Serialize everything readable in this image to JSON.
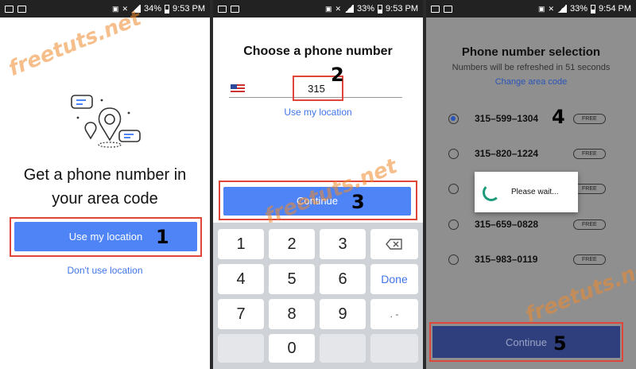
{
  "status_bars": [
    {
      "battery": "34%",
      "time": "9:53 PM"
    },
    {
      "battery": "33%",
      "time": "9:53 PM"
    },
    {
      "battery": "33%",
      "time": "9:54 PM"
    }
  ],
  "watermark": "freetuts.net",
  "screen1": {
    "title_line1": "Get a phone number in",
    "title_line2": "your area code",
    "use_location_button": "Use my location",
    "dont_use_location_link": "Don't use location",
    "step_marker": "1"
  },
  "screen2": {
    "title": "Choose a phone number",
    "area_code_value": "315",
    "use_location_link": "Use my location",
    "continue_button": "Continue",
    "step_marker_input": "2",
    "step_marker_continue": "3",
    "keypad": {
      "keys": [
        "1",
        "2",
        "3",
        "4",
        "5",
        "6",
        "7",
        "8",
        "9",
        "0"
      ],
      "done_label": "Done",
      "symbol_label": ". -"
    }
  },
  "screen3": {
    "title": "Phone number selection",
    "subtitle": "Numbers will be refreshed in 51 seconds",
    "change_area_link": "Change area code",
    "numbers": [
      {
        "number": "315–599–1304",
        "badge": "FREE",
        "selected": true
      },
      {
        "number": "315–820–1224",
        "badge": "FREE",
        "selected": false
      },
      {
        "number": "",
        "badge": "FREE",
        "selected": false
      },
      {
        "number": "315–659–0828",
        "badge": "FREE",
        "selected": false
      },
      {
        "number": "315–983–0119",
        "badge": "FREE",
        "selected": false
      }
    ],
    "dialog_text": "Please wait...",
    "continue_button": "Continue",
    "step_marker_number": "4",
    "step_marker_continue": "5"
  }
}
